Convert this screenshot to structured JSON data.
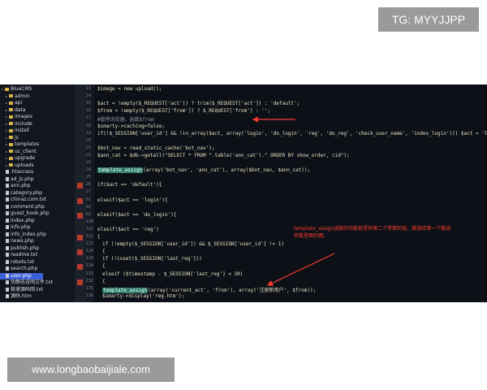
{
  "watermarks": {
    "top": "TG: MYYJJPP",
    "bottom": "www.longbaobaijiale.com"
  },
  "file_tree": {
    "items": [
      {
        "label": "BlueCMS",
        "type": "folder",
        "level": 0
      },
      {
        "label": "admin",
        "type": "folder",
        "level": 1
      },
      {
        "label": "api",
        "type": "folder",
        "level": 1
      },
      {
        "label": "data",
        "type": "folder",
        "level": 1
      },
      {
        "label": "images",
        "type": "folder",
        "level": 1
      },
      {
        "label": "include",
        "type": "folder",
        "level": 1
      },
      {
        "label": "install",
        "type": "folder",
        "level": 1
      },
      {
        "label": "js",
        "type": "folder",
        "level": 1
      },
      {
        "label": "templates",
        "type": "folder",
        "level": 1
      },
      {
        "label": "uc_client",
        "type": "folder",
        "level": 1
      },
      {
        "label": "upgrade",
        "type": "folder",
        "level": 1
      },
      {
        "label": "uploads",
        "type": "folder",
        "level": 1
      },
      {
        "label": ".htaccess",
        "type": "file",
        "level": 1
      },
      {
        "label": "ad_js.php",
        "type": "file",
        "level": 1
      },
      {
        "label": "ann.php",
        "type": "file",
        "level": 1
      },
      {
        "label": "category.php",
        "type": "file",
        "level": 1
      },
      {
        "label": "chinaz.com.txt",
        "type": "file",
        "level": 1
      },
      {
        "label": "comment.php",
        "type": "file",
        "level": 1
      },
      {
        "label": "guest_book.php",
        "type": "file",
        "level": 1
      },
      {
        "label": "index.php",
        "type": "file",
        "level": 1
      },
      {
        "label": "info.php",
        "type": "file",
        "level": 1
      },
      {
        "label": "info_index.php",
        "type": "file",
        "level": 1
      },
      {
        "label": "news.php",
        "type": "file",
        "level": 1
      },
      {
        "label": "publish.php",
        "type": "file",
        "level": 1
      },
      {
        "label": "readme.txt",
        "type": "file",
        "level": 1
      },
      {
        "label": "robots.txt",
        "type": "file",
        "level": 1
      },
      {
        "label": "search.php",
        "type": "file",
        "level": 1
      },
      {
        "label": "user.php",
        "type": "file",
        "level": 1,
        "selected": true
      },
      {
        "label": "伪静态说明文件.txt",
        "type": "file",
        "level": 1
      },
      {
        "label": "极速源码网.txt",
        "type": "file",
        "level": 1
      },
      {
        "label": "源码.htm",
        "type": "file",
        "level": 1
      }
    ]
  },
  "code": {
    "lines": [
      {
        "num": "13",
        "text": "$image = new upload();",
        "indent": 0
      },
      {
        "num": "14",
        "text": "",
        "indent": 0
      },
      {
        "num": "15",
        "text": "$act = !empty($_REQUEST['act']) ? trim($_REQUEST['act']) : 'default';",
        "indent": 0
      },
      {
        "num": "16",
        "text": "$from = !empty($_REQUEST['from']) ? $_REQUEST['from'] : '';",
        "indent": 0
      },
      {
        "num": "17",
        "text": "#暂停浏览器，函数$from",
        "indent": 0,
        "comment": true
      },
      {
        "num": "18",
        "text": "$smarty->caching=false;",
        "indent": 0
      },
      {
        "num": "19",
        "text": "if(!$_SESSION['user_id'] && !in_array($act, array('login', 'do_login', 'reg', 'do_reg', 'check_user_name', 'index_login'))) $act = 'login'; #$act can't control",
        "indent": 0
      },
      {
        "num": "20",
        "text": "",
        "indent": 0
      },
      {
        "num": "21",
        "text": "$bot_nav = read_static_cache('bot_nav');",
        "indent": 0
      },
      {
        "num": "22",
        "text": "$ann_cat = $db->getall(\"SELECT * FROM \".table('ann_cat').\" ORDER BY show_order, cid\");",
        "indent": 0
      },
      {
        "num": "23",
        "text": "",
        "indent": 0
      },
      {
        "num": "24",
        "text": "template_assign(array('bot_nav', 'ann_cat'), array($bot_nav, $ann_cat));",
        "indent": 0,
        "hl": "template_assign"
      },
      {
        "num": "25",
        "text": "",
        "indent": 0
      },
      {
        "num": "26",
        "text": "if($act == 'default'){",
        "indent": 0,
        "marker": true
      },
      {
        "num": "27",
        "text": "",
        "indent": 0
      },
      {
        "num": "61",
        "text": "elseif($act == 'login'){",
        "indent": 0,
        "marker": true
      },
      {
        "num": "62",
        "text": "",
        "indent": 0
      },
      {
        "num": "63",
        "text": "elseif($act == 'do_login'){",
        "indent": 0,
        "marker": true
      },
      {
        "num": "120",
        "text": "",
        "indent": 0
      },
      {
        "num": "121",
        "text": "elseif($act == 'reg')",
        "indent": 0
      },
      {
        "num": "122",
        "text": "{",
        "indent": 0,
        "marker": true
      },
      {
        "num": "123",
        "text": "if (!empty($_SESSION['user_id']) && $_SESSION['user_id'] != 1)",
        "indent": 1
      },
      {
        "num": "124",
        "text": "{",
        "indent": 1,
        "marker": true
      },
      {
        "num": "129",
        "text": "if (!isset($_SESSION['last_reg']))",
        "indent": 1
      },
      {
        "num": "130",
        "text": "{",
        "indent": 1,
        "marker": true
      },
      {
        "num": "131",
        "text": "elseif ($timestamp - $_SESSION['last_reg'] < 30)",
        "indent": 1
      },
      {
        "num": "132",
        "text": "{",
        "indent": 1,
        "marker": true
      },
      {
        "num": "135",
        "text": "template_assign(array('current_act', 'from'), array('注册新用户', $from));",
        "indent": 1,
        "hl": "template_assign"
      },
      {
        "num": "136",
        "text": "$smarty->display('reg.htm');",
        "indent": 1
      }
    ]
  },
  "annotation": {
    "text": "template_assign函数的功能就是将第二个参数的值，赋值给第一个数组参数里面的键。",
    "color": "#ff3b2f"
  },
  "colors": {
    "editor_bg": "#0d1117",
    "highlight": "#2d7d6a",
    "selection": "#3a5fd6",
    "marker": "#b83a2f"
  }
}
